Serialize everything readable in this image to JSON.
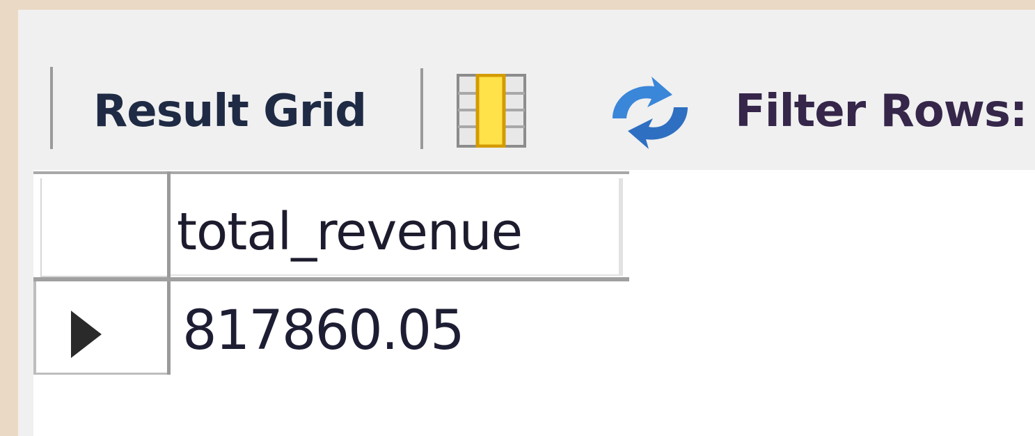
{
  "toolbar": {
    "result_grid_label": "Result Grid",
    "grid_toggle_icon": "grid-column-icon",
    "refresh_icon": "refresh-icon",
    "filter_rows_label": "Filter Rows:"
  },
  "result_grid": {
    "columns": [
      "total_revenue"
    ],
    "rows": [
      {
        "current": true,
        "values": [
          "817860.05"
        ]
      }
    ]
  },
  "colors": {
    "toolbar_bg": "#f0f0f0",
    "outer_bg": "#ead9c4",
    "grid_icon_highlight": "#ffe14a",
    "refresh_icon": "#3a86d9"
  }
}
